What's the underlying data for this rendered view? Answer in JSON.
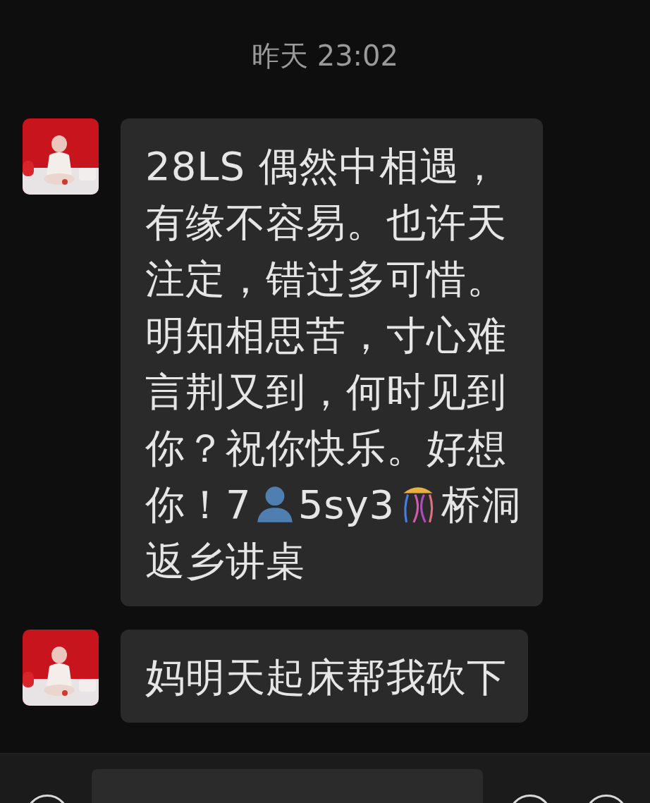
{
  "timestamp": "昨天 23:02",
  "messages": [
    {
      "avatar": {
        "kind": "picture"
      },
      "lines": [
        [
          {
            "kind": "text",
            "text": "28LS 偶然中相遇，"
          }
        ],
        [
          {
            "kind": "text",
            "text": "有缘不容易。也许天"
          }
        ],
        [
          {
            "kind": "text",
            "text": "注定，错过多可惜。"
          }
        ],
        [
          {
            "kind": "text",
            "text": "明知相思苦，寸心难"
          }
        ],
        [
          {
            "kind": "text",
            "text": "言荆又到，何时见到"
          }
        ],
        [
          {
            "kind": "text",
            "text": "你？祝你快乐。好想"
          }
        ],
        [
          {
            "kind": "text",
            "text": "你！7"
          },
          {
            "kind": "person"
          },
          {
            "kind": "text",
            "text": "5sy3"
          },
          {
            "kind": "confetti"
          },
          {
            "kind": "text",
            "text": "桥洞"
          }
        ],
        [
          {
            "kind": "text",
            "text": "返乡讲桌"
          }
        ]
      ]
    },
    {
      "avatar": {
        "kind": "picture"
      },
      "lines": [
        [
          {
            "kind": "text",
            "text": "妈明天起床帮我砍下"
          }
        ]
      ]
    }
  ]
}
